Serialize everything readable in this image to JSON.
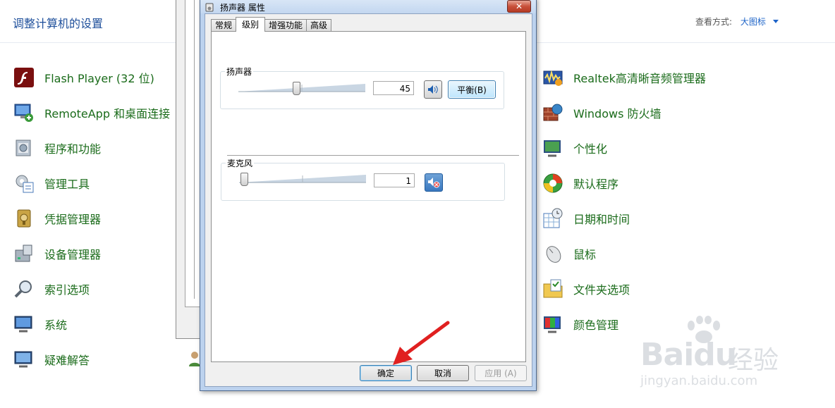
{
  "control_panel": {
    "title": "调整计算机的设置",
    "view_by_label": "查看方式:",
    "view_by_value": "大图标",
    "left_items": [
      {
        "label": "Flash Player (32 位)",
        "icon": "flash-player-icon"
      },
      {
        "label": "RemoteApp 和桌面连接",
        "icon": "remoteapp-icon"
      },
      {
        "label": "程序和功能",
        "icon": "programs-icon"
      },
      {
        "label": "管理工具",
        "icon": "admin-tools-icon"
      },
      {
        "label": "凭据管理器",
        "icon": "credential-manager-icon"
      },
      {
        "label": "设备管理器",
        "icon": "device-manager-icon"
      },
      {
        "label": "索引选项",
        "icon": "indexing-icon"
      },
      {
        "label": "系统",
        "icon": "system-icon"
      },
      {
        "label": "疑难解答",
        "icon": "troubleshooting-icon"
      }
    ],
    "right_items": [
      {
        "label": "Realtek高清晰音频管理器",
        "icon": "realtek-audio-icon"
      },
      {
        "label": "Windows 防火墙",
        "icon": "firewall-icon"
      },
      {
        "label": "个性化",
        "icon": "personalization-icon"
      },
      {
        "label": "默认程序",
        "icon": "default-programs-icon"
      },
      {
        "label": "日期和时间",
        "icon": "date-time-icon"
      },
      {
        "label": "鼠标",
        "icon": "mouse-icon"
      },
      {
        "label": "文件夹选项",
        "icon": "folder-options-icon"
      },
      {
        "label": "颜色管理",
        "icon": "color-management-icon"
      }
    ]
  },
  "dialog": {
    "title": "扬声器 属性",
    "close_label": "✕",
    "tabs": [
      "常规",
      "级别",
      "增强功能",
      "高级"
    ],
    "active_tab": "级别",
    "speaker": {
      "label": "扬声器",
      "level": 45,
      "level_text": "45",
      "balance_label": "平衡(B)",
      "muted": false
    },
    "microphone": {
      "label": "麦克风",
      "level": 1,
      "level_text": "1",
      "muted": true
    },
    "buttons": {
      "ok": "确定",
      "cancel": "取消",
      "apply": "应用 (A)"
    }
  },
  "watermark": {
    "brand": "Baidu",
    "jingyan": "经验",
    "url": "jingyan.baidu.com"
  },
  "colors": {
    "link_green": "#1a6b1a",
    "title_blue": "#1e4f9b",
    "arrow_red": "#e02020"
  }
}
